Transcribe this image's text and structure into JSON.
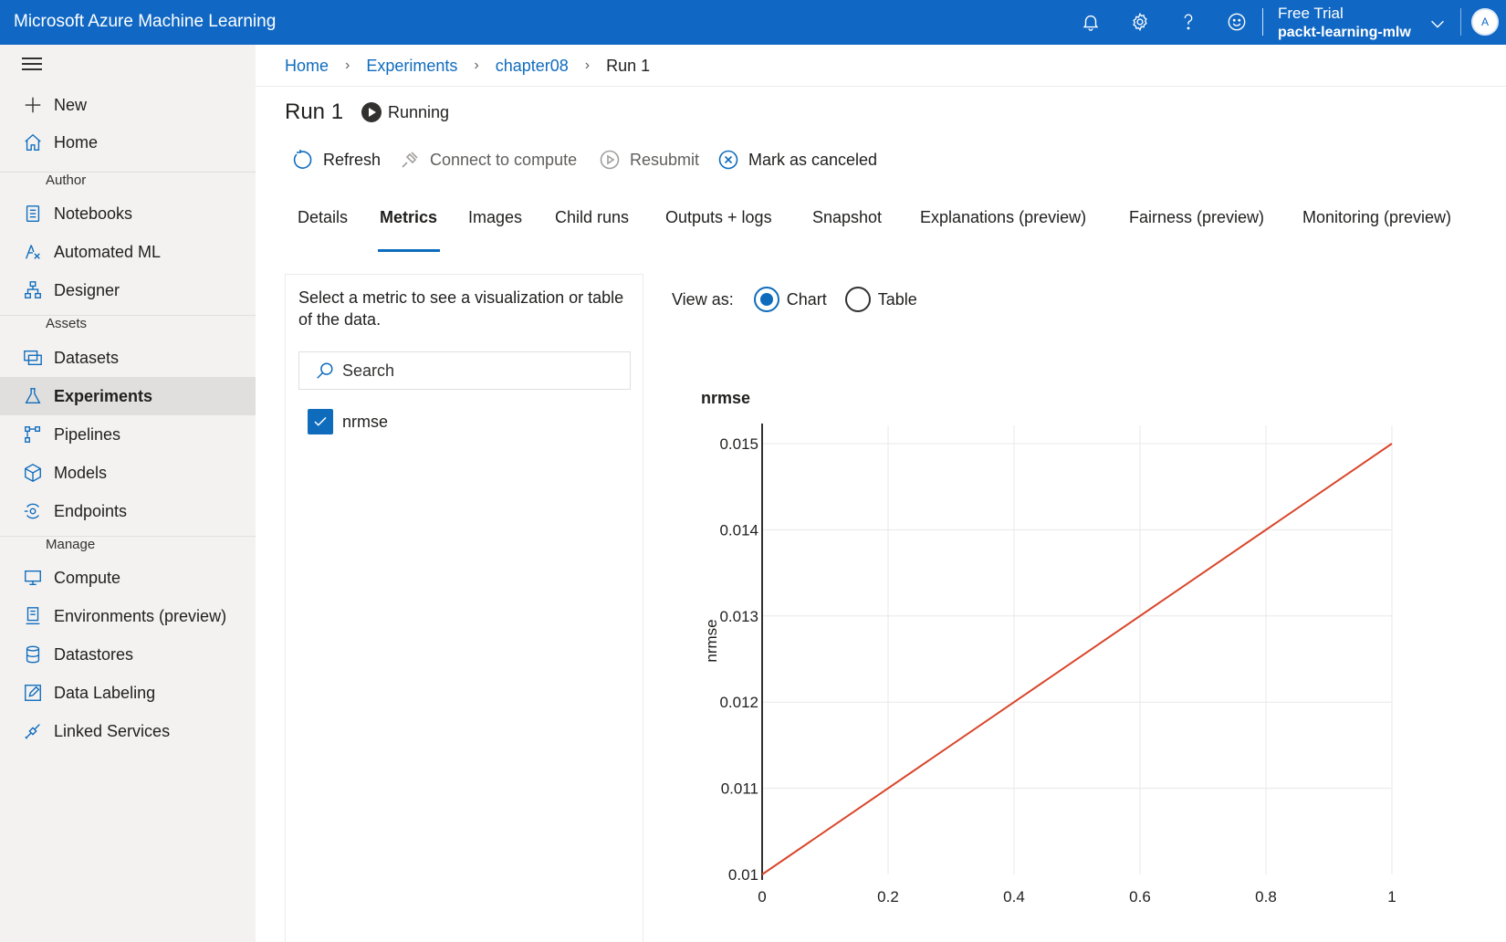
{
  "app": {
    "title": "Microsoft Azure Machine Learning",
    "subscription": "Free Trial",
    "workspace": "packt-learning-mlw",
    "avatar_initial": "A",
    "icons": [
      "bell-icon",
      "gear-icon",
      "help-icon",
      "smiley-icon",
      "chevron-down-icon"
    ]
  },
  "sidebar": {
    "top_items": [
      {
        "label": "New",
        "icon": "plus-icon"
      },
      {
        "label": "Home",
        "icon": "home-icon"
      }
    ],
    "sections": [
      {
        "title": "Author",
        "items": [
          {
            "label": "Notebooks",
            "icon": "notebook-icon"
          },
          {
            "label": "Automated ML",
            "icon": "automl-icon"
          },
          {
            "label": "Designer",
            "icon": "designer-icon"
          }
        ]
      },
      {
        "title": "Assets",
        "items": [
          {
            "label": "Datasets",
            "icon": "dataset-icon"
          },
          {
            "label": "Experiments",
            "icon": "flask-icon",
            "active": true
          },
          {
            "label": "Pipelines",
            "icon": "pipeline-icon"
          },
          {
            "label": "Models",
            "icon": "cube-icon"
          },
          {
            "label": "Endpoints",
            "icon": "endpoint-icon"
          }
        ]
      },
      {
        "title": "Manage",
        "items": [
          {
            "label": "Compute",
            "icon": "monitor-icon"
          },
          {
            "label": "Environments (preview)",
            "icon": "environment-icon"
          },
          {
            "label": "Datastores",
            "icon": "database-icon"
          },
          {
            "label": "Data Labeling",
            "icon": "edit-icon"
          },
          {
            "label": "Linked Services",
            "icon": "link-icon"
          }
        ]
      }
    ]
  },
  "breadcrumb": {
    "items": [
      "Home",
      "Experiments",
      "chapter08"
    ],
    "current": "Run 1"
  },
  "run": {
    "title": "Run 1",
    "status": "Running"
  },
  "toolbar": {
    "refresh": "Refresh",
    "connect": "Connect to compute",
    "resubmit": "Resubmit",
    "cancel": "Mark as canceled"
  },
  "tabs": [
    {
      "label": "Details"
    },
    {
      "label": "Metrics",
      "active": true
    },
    {
      "label": "Images"
    },
    {
      "label": "Child runs"
    },
    {
      "label": "Outputs + logs"
    },
    {
      "label": "Snapshot"
    },
    {
      "label": "Explanations (preview)"
    },
    {
      "label": "Fairness (preview)"
    },
    {
      "label": "Monitoring (preview)"
    }
  ],
  "metrics": {
    "hint": "Select a metric to see a visualization or table of the data.",
    "search_placeholder": "Search",
    "items": [
      {
        "label": "nrmse",
        "checked": true
      }
    ]
  },
  "view_as": {
    "label": "View as:",
    "options": [
      {
        "label": "Chart",
        "checked": true
      },
      {
        "label": "Table",
        "checked": false
      }
    ]
  },
  "chart_data": {
    "type": "line",
    "title": "nrmse",
    "xlabel": "",
    "ylabel": "nrmse",
    "x": [
      0,
      1
    ],
    "y": [
      0.01,
      0.015
    ],
    "xlim": [
      0,
      1
    ],
    "ylim": [
      0.01,
      0.015
    ],
    "x_ticks": [
      "0",
      "0.2",
      "0.4",
      "0.6",
      "0.8",
      "1"
    ],
    "y_ticks": [
      "0.01",
      "0.011",
      "0.012",
      "0.013",
      "0.014",
      "0.015"
    ],
    "grid": true,
    "line_color": "#d9472b"
  },
  "colors": {
    "accent": "#0f6cbd",
    "header_bg": "#1068c4",
    "sidebar_bg": "#f3f2f1"
  }
}
